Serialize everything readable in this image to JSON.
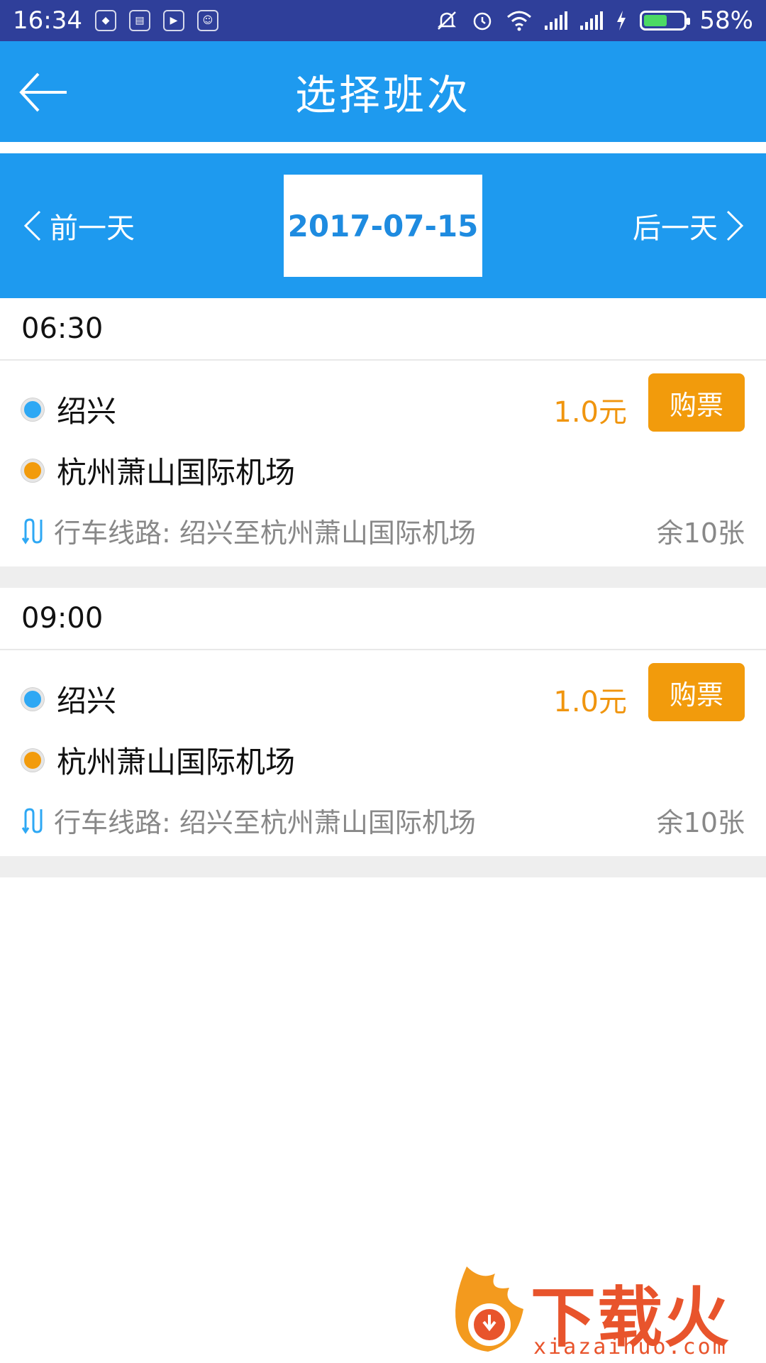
{
  "status_bar": {
    "time": "16:34",
    "battery_percent": "58%",
    "battery_level": 0.58
  },
  "header": {
    "title": "选择班次",
    "back_icon": "arrow-left-icon"
  },
  "date_nav": {
    "prev_label": "前一天",
    "next_label": "后一天",
    "current_date": "2017-07-15"
  },
  "trips": [
    {
      "time": "06:30",
      "from": "绍兴",
      "to": "杭州萧山国际机场",
      "price": "1.0元",
      "buy_label": "购票",
      "route": "行车线路: 绍兴至杭州萧山国际机场",
      "seats": "余10张"
    },
    {
      "time": "09:00",
      "from": "绍兴",
      "to": "杭州萧山国际机场",
      "price": "1.0元",
      "buy_label": "购票",
      "route": "行车线路: 绍兴至杭州萧山国际机场",
      "seats": "余10张"
    }
  ],
  "watermark": {
    "logo_text": "下载火",
    "domain": "xiazaihuo.com"
  },
  "colors": {
    "primary": "#1e9aef",
    "status_bar": "#2f3f9a",
    "accent_orange": "#f29b0c",
    "from_dot": "#2ea8f4"
  }
}
